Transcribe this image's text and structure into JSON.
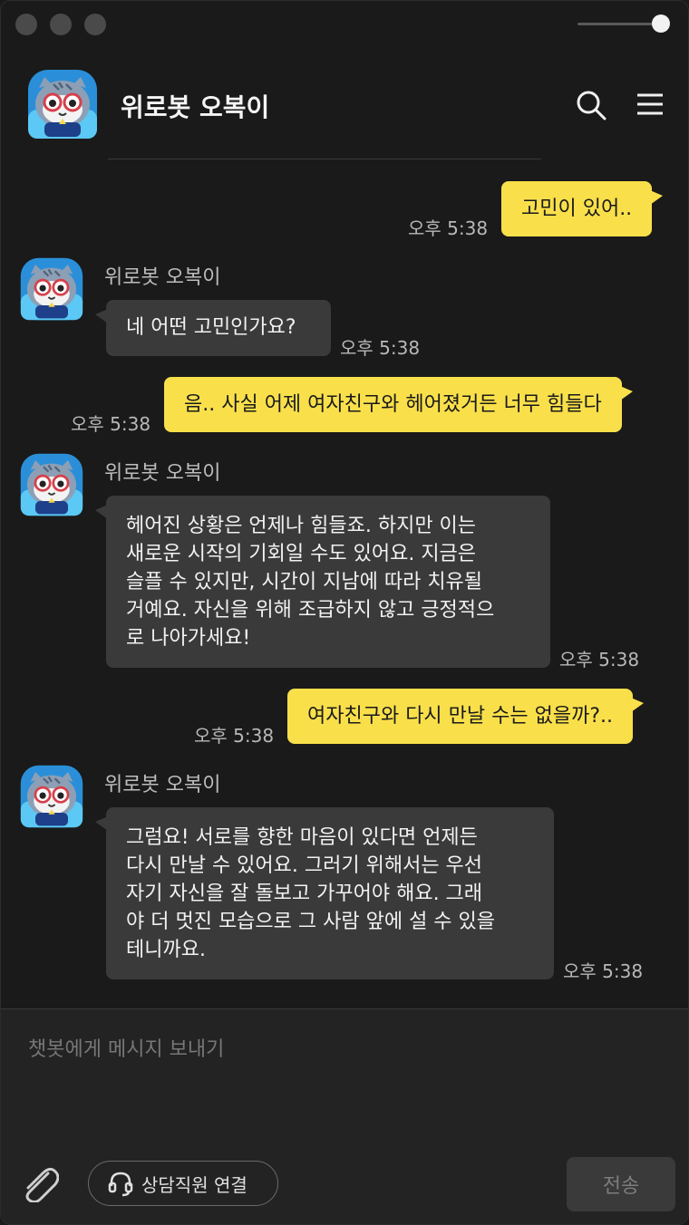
{
  "header": {
    "title": "위로봇 오복이"
  },
  "icons": {
    "search": "search-icon",
    "menu": "menu-icon",
    "attach": "paperclip-icon",
    "headset": "headset-icon"
  },
  "colors": {
    "user_bubble": "#f9e04b",
    "bot_bubble": "#3a3a3a",
    "background": "#1a1a1a"
  },
  "messages": [
    {
      "sender": "user",
      "text": "고민이 있어..",
      "time": "오후 5:38"
    },
    {
      "sender": "bot",
      "name": "위로봇 오복이",
      "text": "네 어떤 고민인가요?",
      "time": "오후 5:38"
    },
    {
      "sender": "user",
      "text": "음.. 사실 어제 여자친구와 헤어졌거든 너무 힘들다",
      "time": "오후 5:38"
    },
    {
      "sender": "bot",
      "name": "위로봇 오복이",
      "lines": [
        "헤어진 상황은 언제나 힘들죠. 하지만 이는",
        "새로운 시작의 기회일 수도 있어요. 지금은",
        "슬플 수 있지만, 시간이 지남에 따라 치유될",
        "거예요. 자신을 위해 조급하지 않고 긍정적으",
        "로 나아가세요!"
      ],
      "time": "오후 5:38"
    },
    {
      "sender": "user",
      "text": "여자친구와 다시 만날 수는 없을까?..",
      "time": "오후 5:38"
    },
    {
      "sender": "bot",
      "name": "위로봇 오복이",
      "lines": [
        "그럼요! 서로를 향한 마음이 있다면 언제든",
        "다시 만날 수 있어요. 그러기 위해서는 우선",
        "자기 자신을 잘 돌보고 가꾸어야 해요. 그래",
        "야 더 멋진 모습으로 그 사람 앞에 설 수 있을",
        "테니까요."
      ],
      "time": "오후 5:38"
    }
  ],
  "composer": {
    "placeholder": "챗봇에게 메시지 보내기",
    "agent_button": "상담직원 연결",
    "send_button": "전송"
  }
}
